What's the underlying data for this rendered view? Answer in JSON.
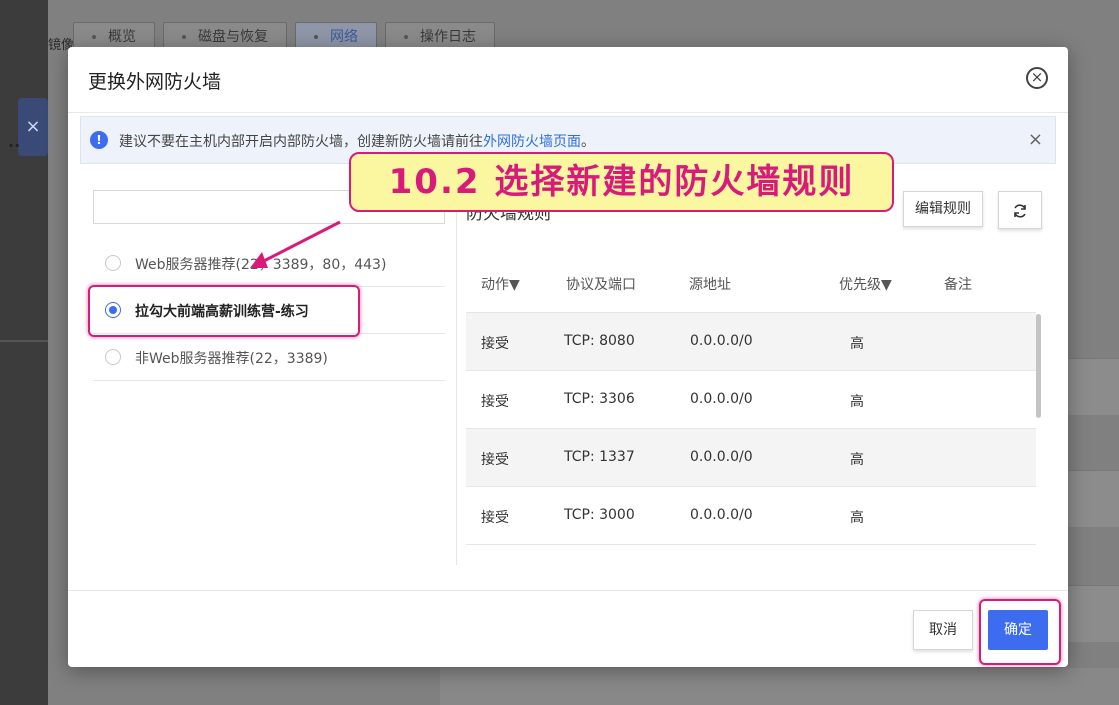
{
  "background": {
    "tabs": [
      "概览",
      "磁盘与恢复",
      "网络",
      "操作日志"
    ],
    "crumb": "镜像管理",
    "dots": ".."
  },
  "modal": {
    "title": "更换外网防火墙",
    "close_icon": "circle-close-icon"
  },
  "alert": {
    "icon": "info-icon",
    "text": "建议不要在主机内部开启内部防火墙，创建新防火墙请前往",
    "link": "外网防火墙页面",
    "suffix": "。",
    "close": "×"
  },
  "search": {
    "placeholder": ""
  },
  "rules": [
    {
      "label": "Web服务器推荐(22，3389，80，443)",
      "selected": false
    },
    {
      "label": "拉勾大前端高薪训练营-练习",
      "selected": true
    },
    {
      "label": "非Web服务器推荐(22，3389)",
      "selected": false
    }
  ],
  "firewall": {
    "title": "防火墙规则",
    "edit_button": "编辑规则",
    "refresh_icon": "refresh-icon",
    "columns": [
      "动作▼",
      "协议及端口",
      "源地址",
      "优先级▼",
      "备注"
    ],
    "rows": [
      {
        "action": "接受",
        "port": "TCP: 8080",
        "source": "0.0.0.0/0",
        "priority": "高",
        "note": ""
      },
      {
        "action": "接受",
        "port": "TCP: 3306",
        "source": "0.0.0.0/0",
        "priority": "高",
        "note": ""
      },
      {
        "action": "接受",
        "port": "TCP: 1337",
        "source": "0.0.0.0/0",
        "priority": "高",
        "note": ""
      },
      {
        "action": "接受",
        "port": "TCP: 3000",
        "source": "0.0.0.0/0",
        "priority": "高",
        "note": ""
      }
    ]
  },
  "footer": {
    "cancel": "取消",
    "ok": "确定"
  },
  "annotation": {
    "callout": "10.2 选择新建的防火墙规则",
    "color": "#d81b7a"
  },
  "colors": {
    "primary": "#3d6cf0",
    "alert_bg": "#eef3fb"
  }
}
